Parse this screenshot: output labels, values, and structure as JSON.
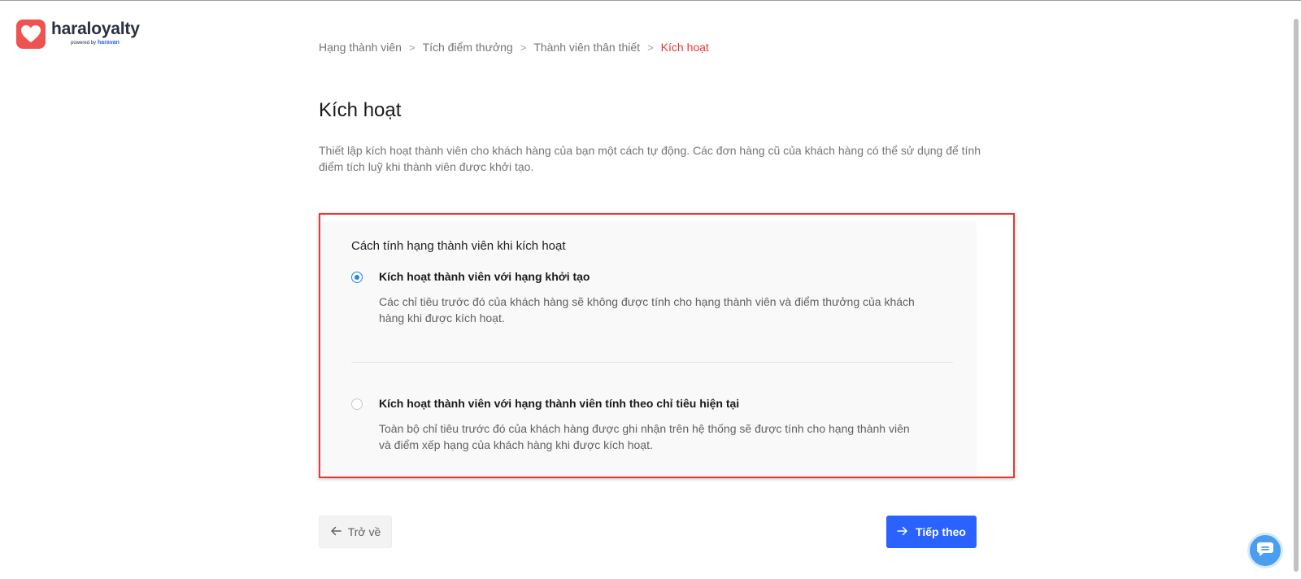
{
  "logo": {
    "wordmark": "haraloyalty",
    "powered_by": "powered by",
    "powered_brand": "haravan"
  },
  "breadcrumb": {
    "items": [
      "Hạng thành viên",
      "Tích điểm thưởng",
      "Thành viên thân thiết"
    ],
    "current": "Kích hoạt",
    "separator": ">"
  },
  "page": {
    "title": "Kích hoạt",
    "description": "Thiết lập kích hoạt thành viên cho khách hàng của bạn một cách tự động. Các đơn hàng cũ của khách hàng có thể sử dụng để tính điểm tích luỹ khi thành viên được khởi tạo."
  },
  "panel": {
    "title": "Cách tính hạng thành viên khi kích hoạt",
    "options": [
      {
        "title": "Kích hoạt thành viên với hạng khởi tạo",
        "description": "Các chỉ tiêu trước đó của khách hàng sẽ không được tính cho hạng thành viên và điểm thưởng của khách hàng khi được kích hoạt.",
        "selected": true
      },
      {
        "title": "Kích hoạt thành viên với hạng thành viên tính theo chỉ tiêu hiện tại",
        "description": "Toàn bộ chỉ tiêu trước đó của khách hàng được ghi nhận trên hệ thống sẽ được tính cho hạng thành viên và điểm xếp hạng của khách hàng khi được kích hoạt.",
        "selected": false
      }
    ]
  },
  "actions": {
    "back_label": "Trở về",
    "next_label": "Tiếp theo"
  },
  "icons": {
    "logo": "heart-icon",
    "back": "arrow-left-icon",
    "next": "arrow-right-icon",
    "chat": "chat-icon"
  },
  "colors": {
    "accent": "#2962ff",
    "breadcrumb_active": "#e53935",
    "logo": "#ef5350",
    "radio_selected": "#1e88e5",
    "highlight_border": "#e53935"
  }
}
